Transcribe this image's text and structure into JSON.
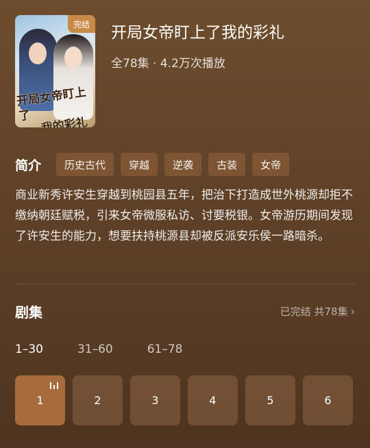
{
  "drama": {
    "title": "开局女帝盯上了我的彩礼",
    "meta": "全78集 · 4.2万次播放",
    "badge": "完结",
    "poster_text_line1": "开局女帝盯上了",
    "poster_text_line2": "我的彩礼"
  },
  "intro": {
    "label": "简介",
    "tags": [
      "历史古代",
      "穿越",
      "逆袭",
      "古装",
      "女帝"
    ],
    "description": "商业新秀许安生穿越到桃园县五年，把治下打造成世外桃源却拒不缴纳朝廷赋税，引来女帝微服私访、讨要税银。女帝游历期间发现了许安生的能力，想要扶持桃源县却被反派安乐侯一路暗杀。"
  },
  "episodes": {
    "title": "剧集",
    "status": "已完结 共78集",
    "ranges": [
      "1–30",
      "31–60",
      "61–78"
    ],
    "active_range": 0,
    "items": [
      "1",
      "2",
      "3",
      "4",
      "5",
      "6"
    ],
    "active_item": 0
  },
  "colors": {
    "accent": "#a86c3c",
    "badge": "#c88a45",
    "background_top": "#6e4d2e",
    "background_bottom": "#4e3420"
  },
  "icons": {
    "playing": "equalizer-bars-icon",
    "status_chevron": "chevron-right-icon"
  }
}
